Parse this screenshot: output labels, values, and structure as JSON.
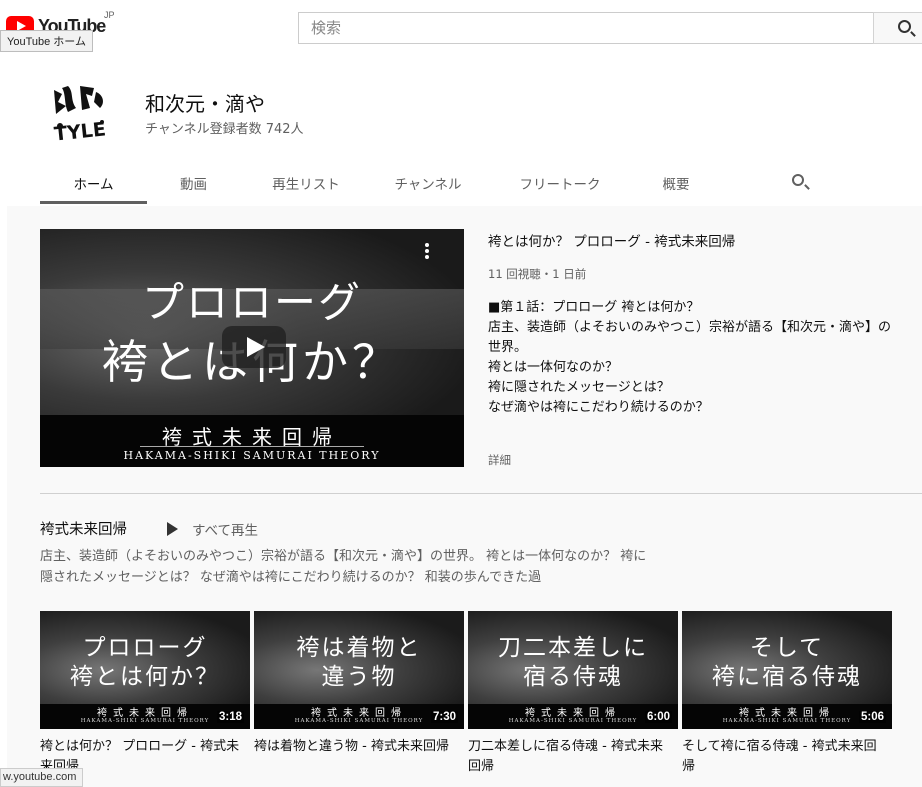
{
  "header": {
    "logo_text": "YouTube",
    "region": "JP",
    "tooltip": "YouTube ホーム",
    "search_placeholder": "検索"
  },
  "channel": {
    "name": "和次元・滴や",
    "subscribers": "チャンネル登録者数 742人",
    "tabs": [
      {
        "label": "ホーム",
        "active": true
      },
      {
        "label": "動画"
      },
      {
        "label": "再生リスト"
      },
      {
        "label": "チャンネル"
      },
      {
        "label": "フリートーク"
      },
      {
        "label": "概要"
      }
    ]
  },
  "featured": {
    "thumb_line1": "プロローグ",
    "thumb_line2": "袴とは何か？",
    "thumb_band_jp": "袴式未来回帰",
    "thumb_band_en": "HAKAMA-SHIKI SAMURAI THEORY",
    "title": "袴とは何か？ プロローグ - 袴式未来回帰",
    "meta": "11 回視聴・1 日前",
    "description": [
      "■第１話：プロローグ 袴とは何か？",
      "",
      "店主、装造師（よそおいのみやつこ）宗裕が語る【和次元・滴や】の世界。",
      "",
      "袴とは一体何なのか？",
      "袴に隠されたメッセージとは？",
      "なぜ滴やは袴にこだわり続けるのか？"
    ],
    "more_label": "詳細"
  },
  "shelf": {
    "title": "袴式未来回帰",
    "play_all": "すべて再生",
    "description": "店主、装造師（よそおいのみやつこ）宗裕が語る【和次元・滴や】の世界。 袴とは一体何なのか？ 袴に隠されたメッセージとは？ なぜ滴やは袴にこだわり続けるのか？ 和装の歩んできた過",
    "videos": [
      {
        "thumb_line1": "プロローグ",
        "thumb_line2": "袴とは何か？",
        "band_jp": "袴式未来回帰",
        "band_en": "HAKAMA-SHIKI SAMURAI THEORY",
        "duration": "3:18",
        "title": "袴とは何か？ プロローグ - 袴式未来回帰"
      },
      {
        "thumb_line1": "袴は着物と",
        "thumb_line2": "違う物",
        "band_jp": "袴式未来回帰",
        "band_en": "HAKAMA-SHIKI SAMURAI THEORY",
        "duration": "7:30",
        "title": "袴は着物と違う物 - 袴式未来回帰"
      },
      {
        "thumb_line1": "刀二本差しに",
        "thumb_line2": "宿る侍魂",
        "band_jp": "袴式未来回帰",
        "band_en": "HAKAMA-SHIKI SAMURAI THEORY",
        "duration": "6:00",
        "title": "刀二本差しに宿る侍魂 - 袴式未来回帰"
      },
      {
        "thumb_line1": "そして",
        "thumb_line2": "袴に宿る侍魂",
        "band_jp": "袴式未来回帰",
        "band_en": "HAKAMA-SHIKI SAMURAI THEORY",
        "duration": "5:06",
        "title": "そして袴に宿る侍魂 - 袴式未来回帰"
      }
    ]
  },
  "status_url": "w.youtube.com",
  "colors": {
    "accent_red": "#ff0000",
    "tab_underline": "#606060",
    "background": "#f9f9f9"
  },
  "icons": [
    "youtube-logo-icon",
    "search-icon",
    "play-icon",
    "more-vert-icon",
    "play-all-icon"
  ]
}
